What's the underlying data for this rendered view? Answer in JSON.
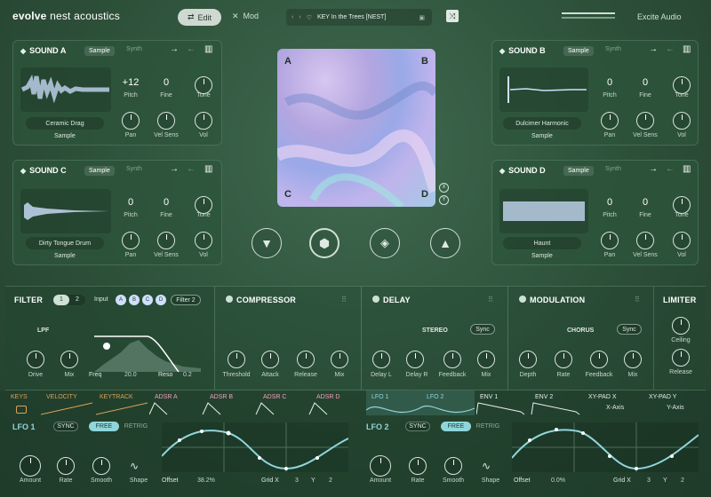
{
  "topbar": {
    "brand_bold": "evolve",
    "brand_rest": "nest acoustics",
    "edit": "Edit",
    "mod": "Mod",
    "preset": "KEY In the Trees [NEST]",
    "company": "Excite Audio"
  },
  "sounds": [
    {
      "id": "a",
      "title": "SOUND A",
      "tab1": "Sample",
      "tab2": "Synth",
      "name": "Ceramic Drag",
      "mode": "Sample",
      "pitch": "+12",
      "fine": "0",
      "tone_l": "Tone",
      "pitch_l": "Pitch",
      "fine_l": "Fine",
      "pan": "Pan",
      "vel": "Vel Sens",
      "vol": "Vol"
    },
    {
      "id": "b",
      "title": "SOUND B",
      "tab1": "Sample",
      "tab2": "Synth",
      "name": "Dulcimer Harmonic",
      "mode": "Sample",
      "pitch": "0",
      "fine": "0",
      "tone_l": "Tone",
      "pitch_l": "Pitch",
      "fine_l": "Fine",
      "pan": "Pan",
      "vel": "Vel Sens",
      "vol": "Vol"
    },
    {
      "id": "c",
      "title": "SOUND C",
      "tab1": "Sample",
      "tab2": "Synth",
      "name": "Dirty Tongue Drum",
      "mode": "Sample",
      "pitch": "0",
      "fine": "0",
      "tone_l": "Tone",
      "pitch_l": "Pitch",
      "fine_l": "Fine",
      "pan": "Pan",
      "vel": "Vel Sens",
      "vol": "Vol"
    },
    {
      "id": "d",
      "title": "SOUND D",
      "tab1": "Sample",
      "tab2": "Synth",
      "name": "Haunt",
      "mode": "Sample",
      "pitch": "0",
      "fine": "0",
      "tone_l": "Tone",
      "pitch_l": "Pitch",
      "fine_l": "Fine",
      "pan": "Pan",
      "vel": "Vel Sens",
      "vol": "Vol"
    }
  ],
  "xypad": {
    "a": "A",
    "b": "B",
    "c": "C",
    "d": "D",
    "x": "X",
    "y": "Y"
  },
  "filter": {
    "title": "FILTER",
    "n1": "1",
    "n2": "2",
    "input": "Input",
    "inA": "A",
    "inB": "B",
    "inC": "C",
    "inD": "D",
    "target": "Filter 2",
    "type": "LPF",
    "drive": "Drive",
    "mix": "Mix",
    "freq": "Freq",
    "freq_v": "20.0",
    "reso": "Reso",
    "reso_v": "0.2"
  },
  "compressor": {
    "title": "COMPRESSOR",
    "threshold": "Threshold",
    "attack": "Attack",
    "release": "Release",
    "mix": "Mix"
  },
  "delay": {
    "title": "DELAY",
    "mode": "STEREO",
    "sync": "Sync",
    "dl": "Delay L",
    "dr": "Delay R",
    "fb": "Feedback",
    "mix": "Mix"
  },
  "modulation": {
    "title": "MODULATION",
    "mode": "CHORUS",
    "sync": "Sync",
    "depth": "Depth",
    "rate": "Rate",
    "fb": "Feedback",
    "mix": "Mix"
  },
  "limiter": {
    "title": "LIMITER",
    "ceiling": "Ceiling",
    "release": "Release"
  },
  "mod_tabs": {
    "keys": "KEYS",
    "velocity": "VELOCITY",
    "keytrack": "KEYTRACK",
    "adsra": "ADSR A",
    "adsrb": "ADSR B",
    "adsrc": "ADSR C",
    "adsrd": "ADSR D",
    "lfo1": "LFO 1",
    "lfo2": "LFO 2",
    "env1": "ENV 1",
    "env2": "ENV 2",
    "xpx": "XY-PAD X",
    "xpy": "XY-PAD Y",
    "xaxis": "X-Axis",
    "yaxis": "Y-Axis"
  },
  "lfo1": {
    "title": "LFO 1",
    "sync": "SYNC",
    "free": "FREE",
    "retrig": "RETRIG",
    "amount": "Amount",
    "rate": "Rate",
    "smooth": "Smooth",
    "shape": "Shape",
    "offset": "Offset",
    "offset_v": "38.2%",
    "grid": "Grid X",
    "gx": "3",
    "gy_l": "Y",
    "gy": "2"
  },
  "lfo2": {
    "title": "LFO 2",
    "sync": "SYNC",
    "free": "FREE",
    "retrig": "RETRIG",
    "amount": "Amount",
    "rate": "Rate",
    "smooth": "Smooth",
    "shape": "Shape",
    "offset": "Offset",
    "offset_v": "0.0%",
    "grid": "Grid X",
    "gx": "3",
    "gy_l": "Y",
    "gy": "2"
  }
}
